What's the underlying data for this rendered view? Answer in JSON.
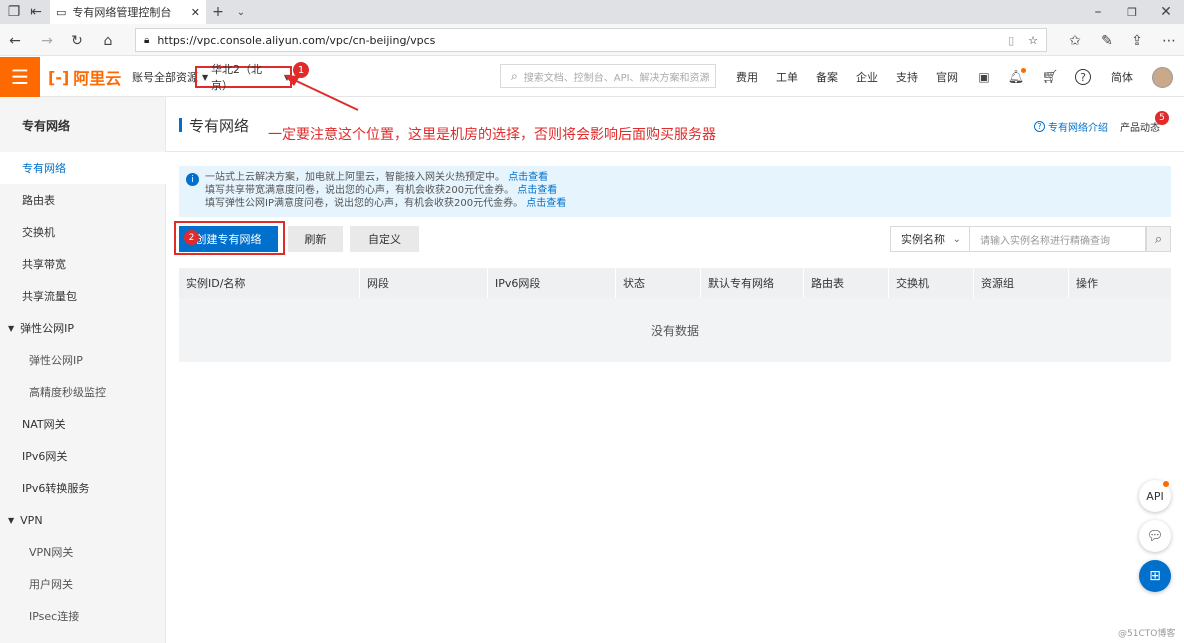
{
  "browser": {
    "tab_title": "专有网络管理控制台",
    "url": "https://vpc.console.aliyun.com/vpc/cn-beijing/vpcs"
  },
  "header": {
    "logo_text": "阿里云",
    "account_resources": "账号全部资源",
    "region": "华北2（北京）",
    "search_placeholder": "搜索文档、控制台、API、解决方案和资源",
    "nav": [
      "费用",
      "工单",
      "备案",
      "企业",
      "支持",
      "官网"
    ],
    "language": "简体"
  },
  "annotations": {
    "marker1": "1",
    "marker2": "2",
    "note": "一定要注意这个位置，这里是机房的选择，否则将会影响后面购买服务器"
  },
  "sidebar": {
    "title": "专有网络",
    "items": [
      {
        "label": "专有网络",
        "type": "active"
      },
      {
        "label": "路由表",
        "type": "item"
      },
      {
        "label": "交换机",
        "type": "item"
      },
      {
        "label": "共享带宽",
        "type": "item"
      },
      {
        "label": "共享流量包",
        "type": "item"
      },
      {
        "label": "弹性公网IP",
        "type": "group"
      },
      {
        "label": "弹性公网IP",
        "type": "sub"
      },
      {
        "label": "高精度秒级监控",
        "type": "sub"
      },
      {
        "label": "NAT网关",
        "type": "item"
      },
      {
        "label": "IPv6网关",
        "type": "item"
      },
      {
        "label": "IPv6转换服务",
        "type": "item"
      },
      {
        "label": "VPN",
        "type": "group"
      },
      {
        "label": "VPN网关",
        "type": "sub"
      },
      {
        "label": "用户网关",
        "type": "sub"
      },
      {
        "label": "IPsec连接",
        "type": "sub"
      }
    ]
  },
  "main": {
    "title": "专有网络",
    "intro_link": "专有网络介绍",
    "product_news": "产品动态",
    "news_badge": "5",
    "notice": [
      {
        "text": "一站式上云解决方案，加电就上阿里云，智能接入网关火热预定中。",
        "link": "点击查看"
      },
      {
        "text": "填写共享带宽满意度问卷，说出您的心声，有机会收获200元代金券。",
        "link": "点击查看"
      },
      {
        "text": "填写弹性公网IP满意度问卷，说出您的心声，有机会收获200元代金券。",
        "link": "点击查看"
      }
    ],
    "buttons": {
      "create": "创建专有网络",
      "refresh": "刷新",
      "customize": "自定义"
    },
    "filter": {
      "select": "实例名称",
      "placeholder": "请输入实例名称进行精确查询"
    },
    "table": {
      "columns": [
        "实例ID/名称",
        "网段",
        "IPv6网段",
        "状态",
        "默认专有网络",
        "路由表",
        "交换机",
        "资源组",
        "操作"
      ],
      "empty": "没有数据"
    }
  },
  "floating": {
    "api": "API"
  },
  "watermark": "@51CTO博客",
  "colors": {
    "brand": "#ff6a00",
    "link": "#0070cc",
    "primary_button": "#0070cc",
    "annotation": "#e02b2b"
  }
}
